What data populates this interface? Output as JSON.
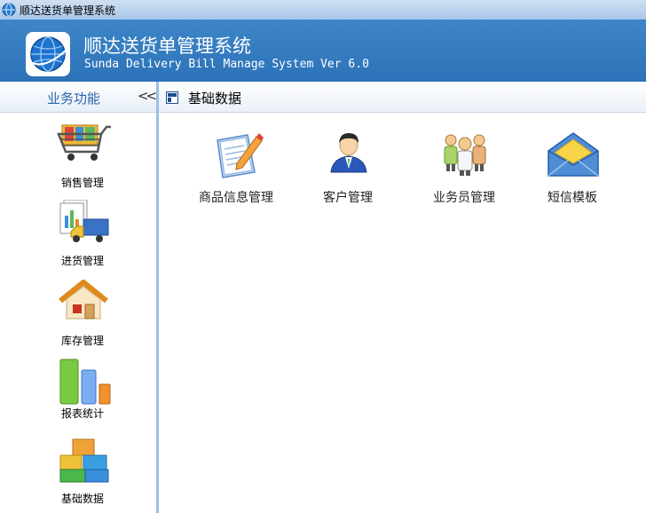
{
  "window": {
    "title": "顺达送货单管理系统"
  },
  "banner": {
    "title": "顺达送货单管理系统",
    "subtitle": "Sunda Delivery Bill Manage System Ver 6.0"
  },
  "sidebar": {
    "header": "业务功能",
    "collapse_glyph": "<<",
    "items": [
      {
        "label": "销售管理",
        "icon": "shopping-cart-icon"
      },
      {
        "label": "进货管理",
        "icon": "delivery-truck-icon"
      },
      {
        "label": "库存管理",
        "icon": "house-icon"
      },
      {
        "label": "报表统计",
        "icon": "bar-chart-icon"
      },
      {
        "label": "基础数据",
        "icon": "stacked-boxes-icon"
      }
    ]
  },
  "content": {
    "header": "基础数据",
    "tiles": [
      {
        "label": "商品信息管理",
        "icon": "notepad-pencil-icon"
      },
      {
        "label": "客户管理",
        "icon": "customer-person-icon"
      },
      {
        "label": "业务员管理",
        "icon": "staff-group-icon"
      },
      {
        "label": "短信模板",
        "icon": "envelope-icon"
      }
    ]
  }
}
